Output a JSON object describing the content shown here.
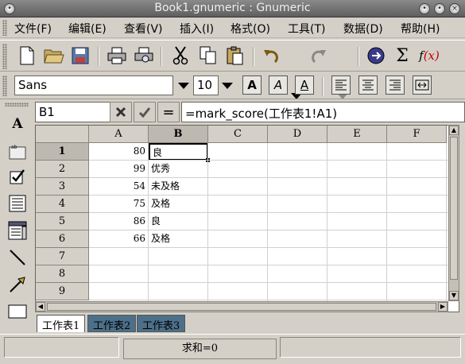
{
  "window": {
    "title": "Book1.gnumeric : Gnumeric"
  },
  "menu": [
    "文件(F)",
    "编辑(E)",
    "查看(V)",
    "插入(I)",
    "格式(O)",
    "工具(T)",
    "数据(D)",
    "帮助(H)"
  ],
  "format": {
    "font": "Sans",
    "size": "10"
  },
  "expr": {
    "cell_ref": "B1",
    "cancel_icon": "x-icon",
    "accept_icon": "check-icon",
    "equals": "=",
    "formula": "=mark_score(工作表1!A1)"
  },
  "columns": [
    "A",
    "B",
    "C",
    "D",
    "E",
    "F"
  ],
  "rows": [
    "1",
    "2",
    "3",
    "4",
    "5",
    "6",
    "7",
    "8",
    "9"
  ],
  "cells": [
    {
      "a": "80",
      "b": "良"
    },
    {
      "a": "99",
      "b": "优秀"
    },
    {
      "a": "54",
      "b": "未及格"
    },
    {
      "a": "75",
      "b": "及格"
    },
    {
      "a": "86",
      "b": "良"
    },
    {
      "a": "66",
      "b": "及格"
    }
  ],
  "sheets": [
    "工作表1",
    "工作表2",
    "工作表3"
  ],
  "status": {
    "sum": "求和=0"
  },
  "colors": {
    "accent": "#4c6f8a"
  }
}
